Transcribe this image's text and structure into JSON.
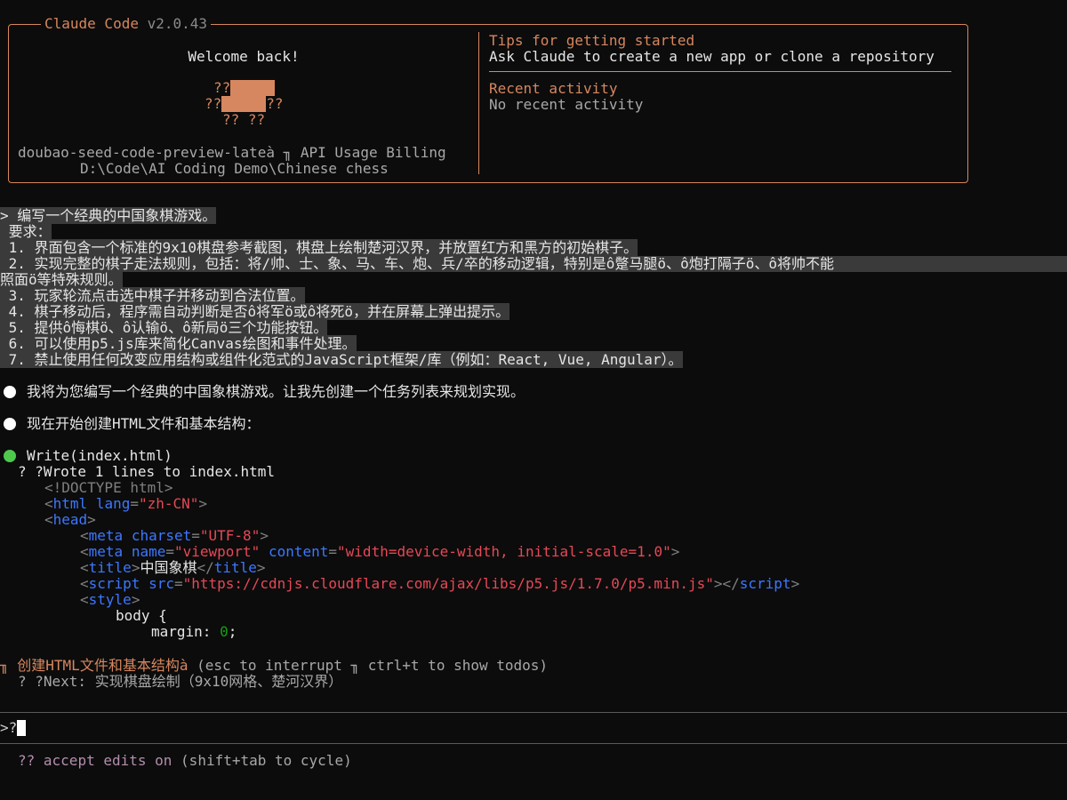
{
  "header": {
    "app_name": "Claude Code",
    "version": "v2.0.43",
    "welcome": "Welcome back!",
    "mascot_row1": "??",
    "mascot_row2a": "??",
    "mascot_row2b": "??",
    "mascot_row3": "?? ??",
    "model_line": "doubao-seed-code-preview-lateà ╖ API Usage Billing",
    "path": "D:\\Code\\AI Coding Demo\\Chinese chess",
    "tips_title": "Tips for getting started",
    "tips_text": "Ask Claude to create a new app or clone a repository",
    "recent_title": "Recent activity",
    "recent_text": "No recent activity"
  },
  "prompt": {
    "lines": [
      "> 编写一个经典的中国象棋游戏。",
      " 要求：",
      " 1. 界面包含一个标准的9x10棋盘参考截图，棋盘上绘制楚河汉界，并放置红方和黑方的初始棋子。",
      " 2. 实现完整的棋子走法规则，包括：将/帅、士、象、马、车、炮、兵/卒的移动逻辑，特别是ô蹩马腿ö、ô炮打隔子ö、ô将帅不能",
      "照面ö等特殊规则。",
      " 3. 玩家轮流点击选中棋子并移动到合法位置。",
      " 4. 棋子移动后，程序需自动判断是否ô将军ö或ô将死ö，并在屏幕上弹出提示。",
      " 5. 提供ô悔棋ö、ô认输ö、ô新局ö三个功能按钮。",
      " 6. 可以使用p5.js库来简化Canvas绘图和事件处理。",
      " 7. 禁止使用任何改变应用结构或组件化范式的JavaScript框架/库（例如：React, Vue, Angular）。"
    ]
  },
  "messages": {
    "msg1": "我将为您编写一个经典的中国象棋游戏。让我先创建一个任务列表来规划实现。",
    "msg2": "现在开始创建HTML文件和基本结构：",
    "tool_call": "Write(index.html)",
    "tool_result": "? ?Wrote 1 lines to index.html"
  },
  "code": {
    "l1": "<!DOCTYPE html>",
    "l2_tag": "html",
    "l2_attr": "lang",
    "l2_val": "\"zh-CN\"",
    "l3_tag": "head",
    "l4_tag": "meta",
    "l4_attr": "charset",
    "l4_val": "\"UTF-8\"",
    "l5_tag": "meta",
    "l5_attr1": "name",
    "l5_val1": "\"viewport\"",
    "l5_attr2": "content",
    "l5_val2": "\"width=device-width, initial-scale=1.0\"",
    "l6_tag": "title",
    "l6_text": "中国象棋",
    "l7_tag": "script",
    "l7_attr": "src",
    "l7_val": "\"https://cdnjs.cloudflare.com/ajax/libs/p5.js/1.7.0/p5.min.js\"",
    "l8_tag": "style",
    "l9": "body {",
    "l10_prop": "margin",
    "l10_val": "0"
  },
  "status": {
    "spinner": "╖",
    "task": "创建HTML文件和基本结构à",
    "hint": "(esc to interrupt ╖ ctrl+t to show todos)",
    "next_prefix": "? ?Next:",
    "next_text": "实现棋盘绘制（9x10网格、楚河汉界）"
  },
  "input": {
    "prompt_char": ">?",
    "mode_icon": "??",
    "mode_text": "accept edits on",
    "mode_hint": "(shift+tab to cycle)"
  },
  "colors": {
    "accent": "#d7875f",
    "background": "#0c0c0c",
    "success": "#4ec94e",
    "mode": "#b48ead"
  }
}
